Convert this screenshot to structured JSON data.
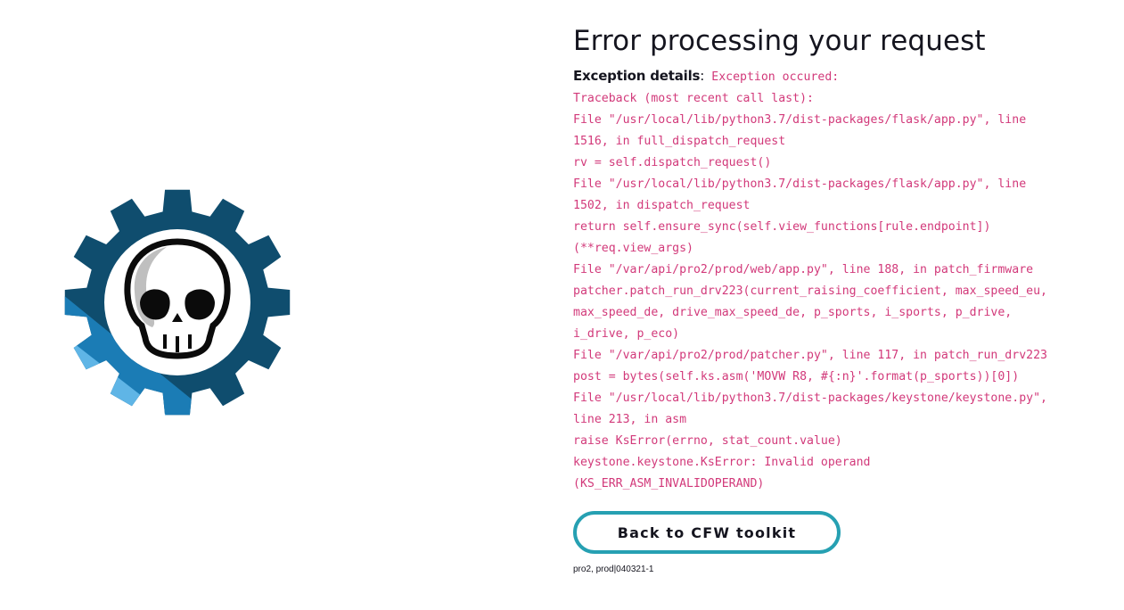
{
  "page": {
    "title": "Error processing your request",
    "exception_label": "Exception details",
    "exception_separator": ":",
    "traceback_lines": [
      "Exception occured:",
      "Traceback (most recent call last):",
      "File \"/usr/local/lib/python3.7/dist-packages/flask/app.py\", line",
      "1516, in full_dispatch_request",
      "rv = self.dispatch_request()",
      "File \"/usr/local/lib/python3.7/dist-packages/flask/app.py\", line",
      "1502, in dispatch_request",
      "return self.ensure_sync(self.view_functions[rule.endpoint])",
      "(**req.view_args)",
      "File \"/var/api/pro2/prod/web/app.py\", line 188, in patch_firmware",
      "patcher.patch_run_drv223(current_raising_coefficient, max_speed_eu,",
      "max_speed_de, drive_max_speed_de, p_sports, i_sports, p_drive,",
      "i_drive, p_eco)",
      "File \"/var/api/pro2/prod/patcher.py\", line 117, in patch_run_drv223",
      "post = bytes(self.ks.asm('MOVW R8, #{:n}'.format(p_sports))[0])",
      "File \"/usr/local/lib/python3.7/dist-packages/keystone/keystone.py\",",
      "line 213, in asm",
      "raise KsError(errno, stat_count.value)",
      "keystone.keystone.KsError: Invalid operand",
      "(KS_ERR_ASM_INVALIDOPERAND)"
    ],
    "back_button_label": "Back to CFW toolkit",
    "version": "pro2, prod|040321-1"
  },
  "logo": {
    "icon": "gear-skull-icon",
    "colors": {
      "gear_dark": "#0f4d6e",
      "gear_mid": "#1b7cb5",
      "gear_light": "#5fb5e6",
      "skull_outline": "#0b0b0b",
      "skull_shade": "#bfbfbf"
    }
  },
  "colors": {
    "traceback_text": "#d2397a",
    "button_border": "#26a0b2",
    "title_text": "#15151f"
  }
}
